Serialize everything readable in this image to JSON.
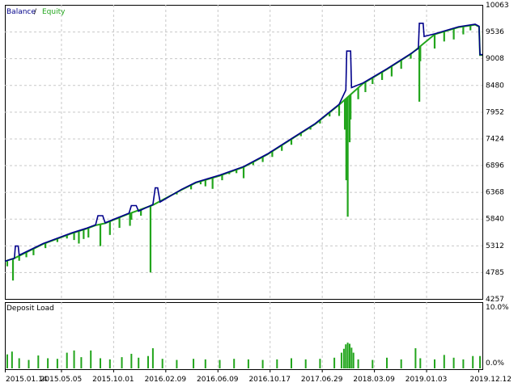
{
  "colors": {
    "balance": "#00008b",
    "equity": "#22a51c",
    "load": "#22a51c",
    "grid": "#c8c8c8",
    "frame": "#000000",
    "background": "#ffffff"
  },
  "chart_data": [
    {
      "type": "line",
      "grid": true,
      "legend_position": "top-left",
      "legend": [
        {
          "label": "Balance",
          "color": "#00008b"
        },
        {
          "label": "Equity",
          "color": "#22a51c"
        }
      ],
      "legend_separator": " / ",
      "ylim": [
        4257,
        10063
      ],
      "y_ticks": [
        "10063",
        "9536",
        "9008",
        "8480",
        "7952",
        "7424",
        "6896",
        "6368",
        "5840",
        "5312",
        "4785",
        "4257"
      ],
      "x_ticks": [
        "2015.01.14",
        "2015.05.05",
        "2015.10.01",
        "2016.02.09",
        "2016.06.09",
        "2016.10.17",
        "2017.06.29",
        "2018.03.09",
        "2019.01.03",
        "2019.12.12"
      ],
      "series": [
        {
          "name": "Balance",
          "points": [
            [
              0,
              5000
            ],
            [
              0.02,
              5060
            ],
            [
              0.022,
              5300
            ],
            [
              0.028,
              5300
            ],
            [
              0.03,
              5120
            ],
            [
              0.08,
              5350
            ],
            [
              0.14,
              5560
            ],
            [
              0.17,
              5650
            ],
            [
              0.19,
              5720
            ],
            [
              0.195,
              5900
            ],
            [
              0.205,
              5900
            ],
            [
              0.21,
              5760
            ],
            [
              0.26,
              5950
            ],
            [
              0.265,
              6100
            ],
            [
              0.275,
              6100
            ],
            [
              0.28,
              5990
            ],
            [
              0.31,
              6120
            ],
            [
              0.315,
              6450
            ],
            [
              0.32,
              6450
            ],
            [
              0.325,
              6170
            ],
            [
              0.37,
              6420
            ],
            [
              0.4,
              6560
            ],
            [
              0.45,
              6700
            ],
            [
              0.5,
              6870
            ],
            [
              0.55,
              7120
            ],
            [
              0.6,
              7420
            ],
            [
              0.65,
              7720
            ],
            [
              0.7,
              8100
            ],
            [
              0.714,
              8380
            ],
            [
              0.716,
              9150
            ],
            [
              0.724,
              9150
            ],
            [
              0.726,
              8430
            ],
            [
              0.75,
              8520
            ],
            [
              0.8,
              8800
            ],
            [
              0.85,
              9100
            ],
            [
              0.866,
              9200
            ],
            [
              0.868,
              9700
            ],
            [
              0.876,
              9700
            ],
            [
              0.878,
              9440
            ],
            [
              0.9,
              9490
            ],
            [
              0.95,
              9630
            ],
            [
              0.985,
              9680
            ],
            [
              0.993,
              9640
            ],
            [
              0.995,
              9080
            ],
            [
              1,
              9080
            ]
          ]
        },
        {
          "name": "Equity",
          "points": [
            [
              0,
              5000
            ],
            [
              0.02,
              5060
            ],
            [
              0.08,
              5340
            ],
            [
              0.14,
              5550
            ],
            [
              0.17,
              5640
            ],
            [
              0.19,
              5710
            ],
            [
              0.21,
              5750
            ],
            [
              0.26,
              5940
            ],
            [
              0.31,
              6110
            ],
            [
              0.37,
              6410
            ],
            [
              0.4,
              6550
            ],
            [
              0.45,
              6690
            ],
            [
              0.5,
              6860
            ],
            [
              0.55,
              7110
            ],
            [
              0.6,
              7410
            ],
            [
              0.65,
              7710
            ],
            [
              0.7,
              8090
            ],
            [
              0.75,
              8510
            ],
            [
              0.8,
              8790
            ],
            [
              0.85,
              9090
            ],
            [
              0.9,
              9480
            ],
            [
              0.95,
              9620
            ],
            [
              0.985,
              9670
            ],
            [
              0.993,
              9630
            ],
            [
              0.995,
              9070
            ],
            [
              1,
              9070
            ]
          ],
          "drawdowns": [
            [
              0.005,
              4900
            ],
            [
              0.017,
              4620
            ],
            [
              0.03,
              5010
            ],
            [
              0.045,
              5080
            ],
            [
              0.06,
              5120
            ],
            [
              0.085,
              5260
            ],
            [
              0.11,
              5380
            ],
            [
              0.13,
              5450
            ],
            [
              0.145,
              5420
            ],
            [
              0.155,
              5350
            ],
            [
              0.165,
              5440
            ],
            [
              0.175,
              5470
            ],
            [
              0.2,
              5300
            ],
            [
              0.22,
              5520
            ],
            [
              0.24,
              5660
            ],
            [
              0.262,
              5700
            ],
            [
              0.265,
              5820
            ],
            [
              0.285,
              5900
            ],
            [
              0.305,
              4780
            ],
            [
              0.33,
              6220
            ],
            [
              0.36,
              6320
            ],
            [
              0.39,
              6420
            ],
            [
              0.41,
              6520
            ],
            [
              0.42,
              6480
            ],
            [
              0.435,
              6430
            ],
            [
              0.455,
              6600
            ],
            [
              0.47,
              6720
            ],
            [
              0.485,
              6740
            ],
            [
              0.5,
              6640
            ],
            [
              0.52,
              6900
            ],
            [
              0.54,
              6960
            ],
            [
              0.56,
              7060
            ],
            [
              0.58,
              7180
            ],
            [
              0.6,
              7300
            ],
            [
              0.62,
              7470
            ],
            [
              0.64,
              7600
            ],
            [
              0.66,
              7720
            ],
            [
              0.68,
              7860
            ],
            [
              0.7,
              7870
            ],
            [
              0.712,
              7600
            ],
            [
              0.715,
              6600
            ],
            [
              0.718,
              5880
            ],
            [
              0.722,
              7350
            ],
            [
              0.724,
              7800
            ],
            [
              0.74,
              8200
            ],
            [
              0.755,
              8340
            ],
            [
              0.77,
              8500
            ],
            [
              0.79,
              8580
            ],
            [
              0.81,
              8650
            ],
            [
              0.83,
              8800
            ],
            [
              0.85,
              9000
            ],
            [
              0.868,
              8150
            ],
            [
              0.87,
              8950
            ],
            [
              0.9,
              9200
            ],
            [
              0.92,
              9340
            ],
            [
              0.94,
              9380
            ],
            [
              0.96,
              9480
            ],
            [
              0.975,
              9560
            ]
          ]
        }
      ]
    },
    {
      "type": "bar",
      "title": "Deposit Load",
      "legend_position": "top-left",
      "ylim": [
        0,
        10
      ],
      "y_ticks": [
        "10.0%",
        "0.0%"
      ],
      "y_unit": "%",
      "bars": [
        [
          0.005,
          1.5
        ],
        [
          0.015,
          2.0
        ],
        [
          0.03,
          0.8
        ],
        [
          0.05,
          0.5
        ],
        [
          0.07,
          1.3
        ],
        [
          0.09,
          0.8
        ],
        [
          0.11,
          0.7
        ],
        [
          0.13,
          1.8
        ],
        [
          0.145,
          2.2
        ],
        [
          0.16,
          1.0
        ],
        [
          0.18,
          2.2
        ],
        [
          0.2,
          0.8
        ],
        [
          0.22,
          0.6
        ],
        [
          0.245,
          1.0
        ],
        [
          0.265,
          1.6
        ],
        [
          0.28,
          0.9
        ],
        [
          0.3,
          1.2
        ],
        [
          0.31,
          2.6
        ],
        [
          0.33,
          0.7
        ],
        [
          0.36,
          0.5
        ],
        [
          0.395,
          0.7
        ],
        [
          0.42,
          0.6
        ],
        [
          0.45,
          0.5
        ],
        [
          0.48,
          0.7
        ],
        [
          0.51,
          0.6
        ],
        [
          0.54,
          0.5
        ],
        [
          0.57,
          0.6
        ],
        [
          0.6,
          0.8
        ],
        [
          0.63,
          0.6
        ],
        [
          0.66,
          0.7
        ],
        [
          0.69,
          0.9
        ],
        [
          0.705,
          1.8
        ],
        [
          0.71,
          2.5
        ],
        [
          0.714,
          3.3
        ],
        [
          0.718,
          3.6
        ],
        [
          0.722,
          3.4
        ],
        [
          0.726,
          2.7
        ],
        [
          0.73,
          1.8
        ],
        [
          0.74,
          0.6
        ],
        [
          0.77,
          0.5
        ],
        [
          0.8,
          0.9
        ],
        [
          0.83,
          0.6
        ],
        [
          0.86,
          2.6
        ],
        [
          0.87,
          0.8
        ],
        [
          0.9,
          0.6
        ],
        [
          0.92,
          1.4
        ],
        [
          0.94,
          0.9
        ],
        [
          0.96,
          0.6
        ],
        [
          0.98,
          1.2
        ],
        [
          0.995,
          1.2
        ]
      ]
    }
  ]
}
